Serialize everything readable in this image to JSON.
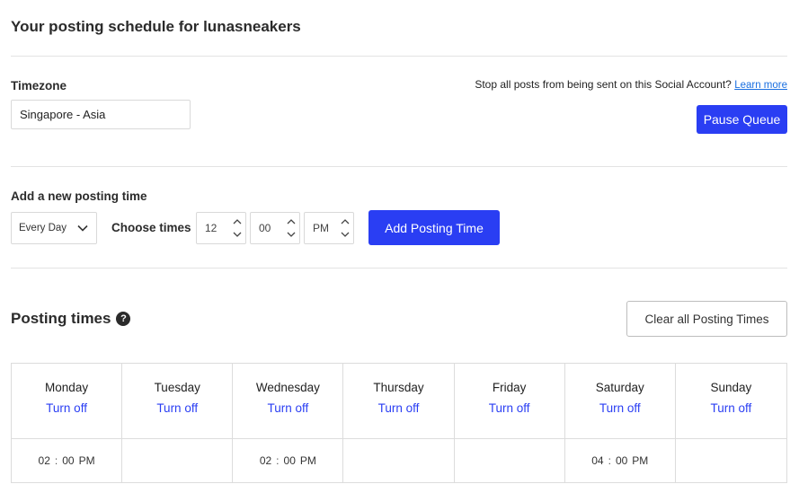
{
  "header": {
    "title": "Your posting schedule for lunasneakers"
  },
  "timezone": {
    "label": "Timezone",
    "value": "Singapore - Asia",
    "stop_text": "Stop all posts from being sent on this Social Account?",
    "learn_more": "Learn more",
    "pause_label": "Pause Queue"
  },
  "add_time": {
    "label": "Add a new posting time",
    "frequency": "Every Day",
    "choose_label": "Choose times",
    "hour": "12",
    "minute": "00",
    "ampm": "PM",
    "add_label": "Add Posting Time"
  },
  "posting_times": {
    "title": "Posting times",
    "help": "?",
    "clear_label": "Clear all Posting Times",
    "turn_off_label": "Turn off",
    "days": [
      {
        "name": "Monday",
        "time": {
          "h": "02",
          "m": "00",
          "p": "PM"
        }
      },
      {
        "name": "Tuesday",
        "time": null
      },
      {
        "name": "Wednesday",
        "time": {
          "h": "02",
          "m": "00",
          "p": "PM"
        }
      },
      {
        "name": "Thursday",
        "time": null
      },
      {
        "name": "Friday",
        "time": null
      },
      {
        "name": "Saturday",
        "time": {
          "h": "04",
          "m": "00",
          "p": "PM"
        }
      },
      {
        "name": "Sunday",
        "time": null
      }
    ]
  },
  "colors": {
    "accent": "#2a3ef3",
    "link": "#1a6fe0",
    "border": "#dcdcdc"
  }
}
